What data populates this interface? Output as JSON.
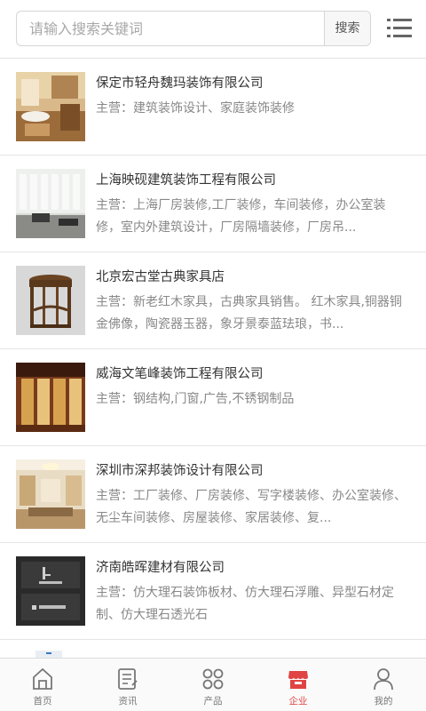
{
  "search": {
    "placeholder": "请输入搜索关键词",
    "button_label": "搜索"
  },
  "companies": [
    {
      "name": "保定市轻舟魏玛装饰有限公司",
      "business": "主营：建筑装饰设计、家庭装饰装修"
    },
    {
      "name": "上海映砚建筑装饰工程有限公司",
      "business": "主营：上海厂房装修,工厂装修，车间装修，办公室装修，室内外建筑设计，厂房隔墙装修，厂房吊..."
    },
    {
      "name": "北京宏古堂古典家具店",
      "business": "主营：新老红木家具，古典家具销售。 红木家具,铜器铜金佛像，陶瓷器玉器，象牙景泰蓝珐琅，书..."
    },
    {
      "name": "威海文笔峰装饰工程有限公司",
      "business": "主营：钢结构,门窗,广告,不锈钢制品"
    },
    {
      "name": "深圳市深邦装饰设计有限公司",
      "business": "主营：工厂装修、厂房装修、写字楼装修、办公室装修、无尘车间装修、房屋装修、家居装修、复..."
    },
    {
      "name": "济南皓晖建材有限公司",
      "business": "主营：仿大理石装饰板材、仿大理石浮雕、异型石材定制、仿大理石透光石"
    }
  ],
  "tabbar": {
    "home": "首页",
    "news": "资讯",
    "products": "产品",
    "companies": "企业",
    "mine": "我的"
  },
  "colors": {
    "accent": "#e04343",
    "text": "#333333",
    "muted": "#888888"
  }
}
